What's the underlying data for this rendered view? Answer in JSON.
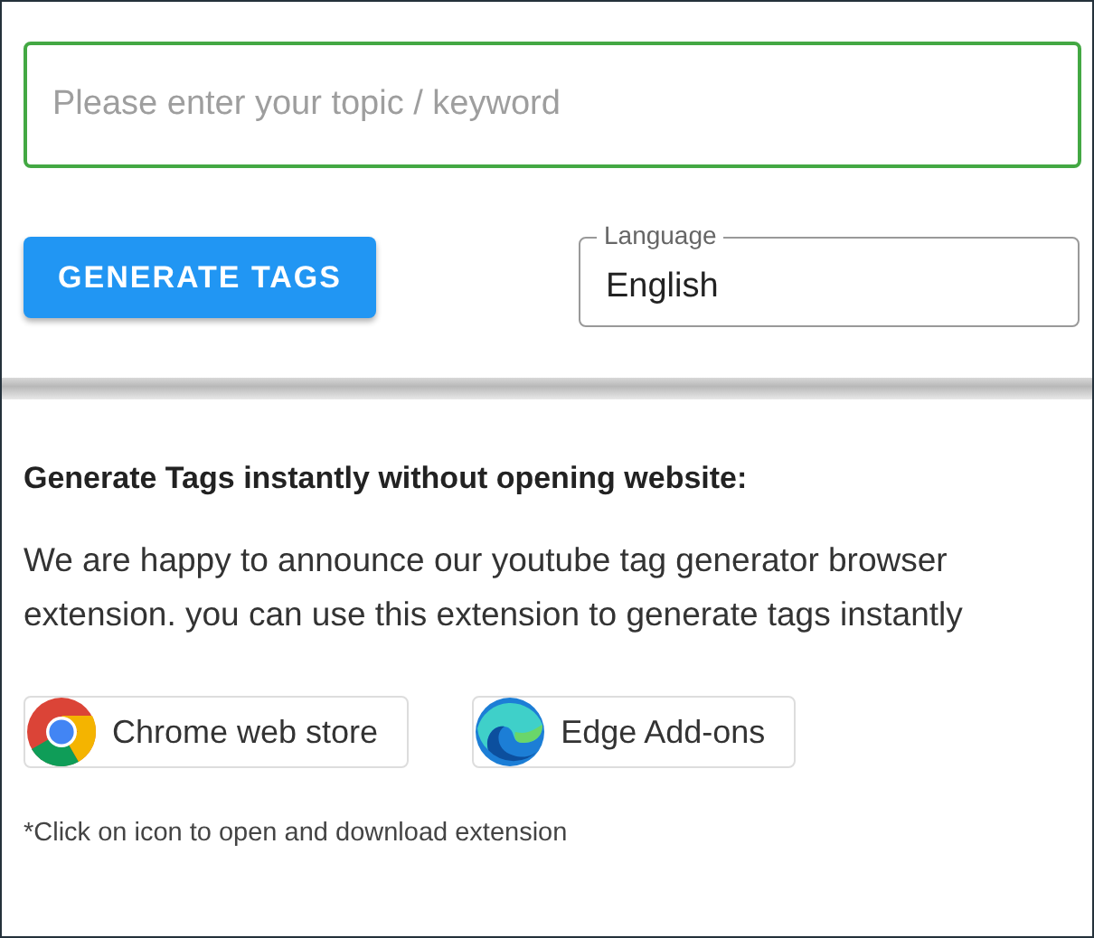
{
  "search": {
    "placeholder": "Please enter your topic / keyword",
    "focused": true
  },
  "generate_button": {
    "label": "GENERATE TAGS"
  },
  "language": {
    "label": "Language",
    "value": "English"
  },
  "extension": {
    "heading": "Generate Tags instantly without opening website:",
    "text": "We are happy to announce our youtube tag generator browser extension. you can use this extension to generate tags instantly",
    "stores": [
      {
        "kind": "chrome",
        "label": "Chrome web store"
      },
      {
        "kind": "edge",
        "label": "Edge Add-ons"
      }
    ],
    "note": "*Click on icon to open and download extension"
  }
}
